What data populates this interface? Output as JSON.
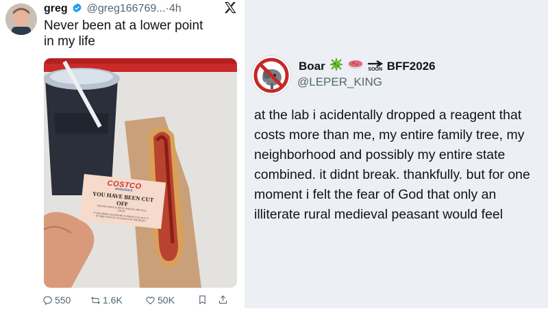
{
  "left_tweet": {
    "name": "greg",
    "handle": "@greg166769...",
    "separator": "·",
    "time": "4h",
    "text_line1": "Never been at a lower point",
    "text_line2": "in my life",
    "card": {
      "logo": "COSTCO",
      "logo_sub": "WHOLESALE",
      "title": "YOU HAVE BEEN CUT OFF",
      "line1": "PLEASE LEAVE QUIETLY AND NO ONE WILL",
      "line2": "KNOW",
      "line3": "IT HAS BEEN A PLEASURE TO SERVE YOU, BUT IT",
      "line4": "IS TIME FOR YOU TO LEAVE FOR THE NIGHT."
    },
    "actions": {
      "replies": "550",
      "reposts": "1.6K",
      "likes": "50K"
    }
  },
  "right_tweet": {
    "name": "Boar",
    "soon_label": "SOON",
    "tag": "BFF2026",
    "handle": "@LEPER_KING",
    "text": "at the lab i acidentally dropped a reagent that costs more than me, my entire family tree, my neighborhood and possibly my entire state combined. it didnt break. thankfully. but for one moment i felt the fear of God that only an illiterate rural medieval peasant would feel"
  },
  "colors": {
    "verified_blue": "#1d9bf0",
    "muted_text": "#536471",
    "right_background": "#eceff3",
    "costco_red": "#d0312d",
    "costco_blue": "#1a4f9c"
  }
}
